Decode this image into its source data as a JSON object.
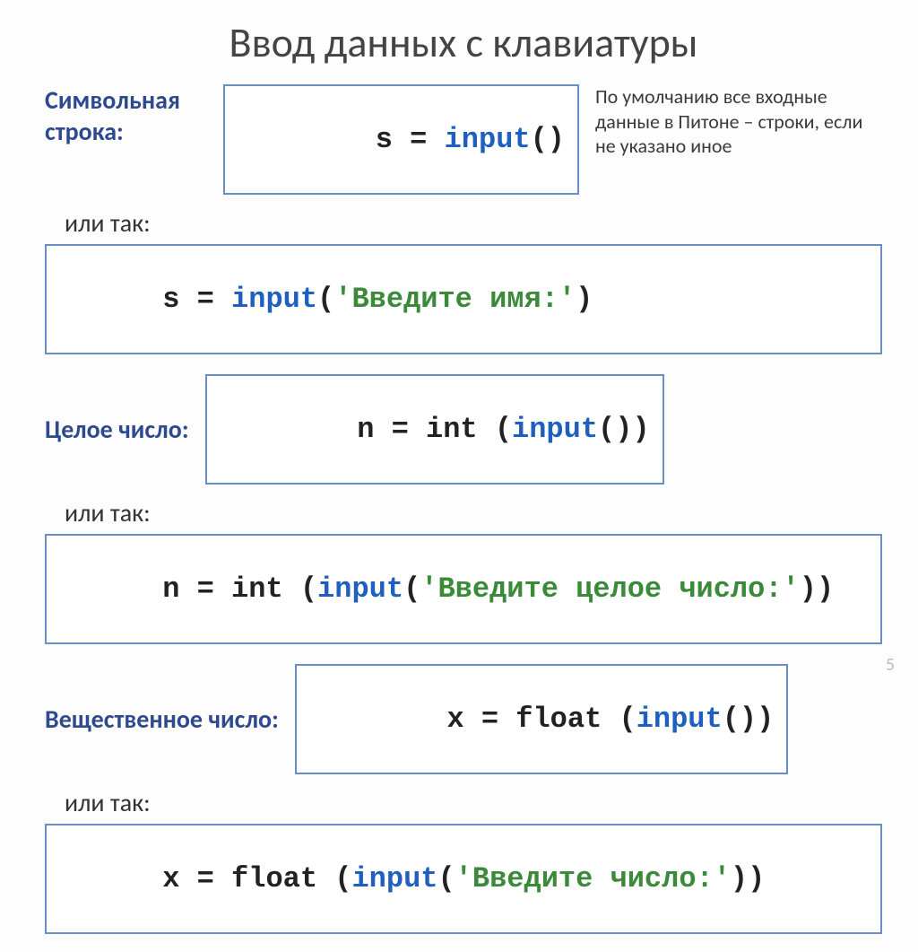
{
  "title": "Ввод данных с клавиатуры",
  "row1_label": "Символьная строка:",
  "row1_code": {
    "pre": "s = ",
    "fn": "input",
    "post": "()"
  },
  "note": "По умолчанию все входные данные в Питоне – строки, если не указано иное",
  "or": "или так:",
  "row2_code": {
    "pre": "s = ",
    "fn": "input",
    "paren_open": "(",
    "str": "'Введите имя:'",
    "paren_close": ")"
  },
  "row3_label": "Целое число:",
  "row3_code": {
    "pre": "n = int (",
    "fn": "input",
    "post": "())"
  },
  "row4_code": {
    "pre": "n = int (",
    "fn": "input",
    "paren_open": "(",
    "str": "'Введите целое число:'",
    "paren_close": "))"
  },
  "row5_label": "Вещественное число:",
  "row5_code": {
    "pre": "x = float (",
    "fn": "input",
    "post": "())"
  },
  "row6_code": {
    "pre": "x = float (",
    "fn": "input",
    "paren_open": "(",
    "str": "'Введите число:'",
    "paren_close": "))"
  },
  "page": "5"
}
